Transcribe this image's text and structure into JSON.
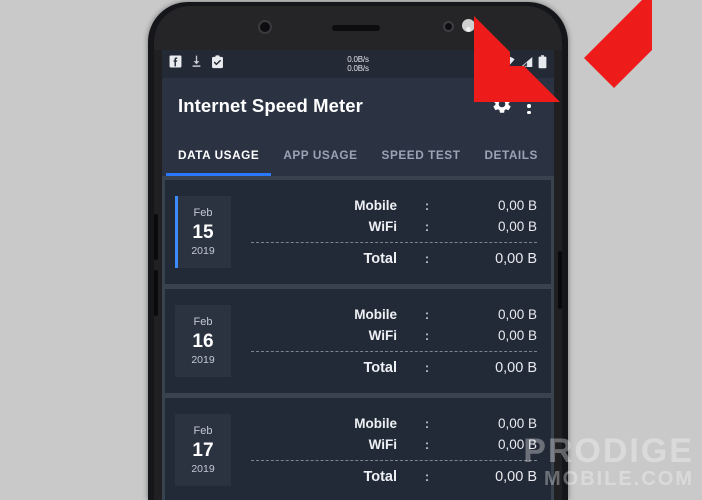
{
  "statusbar": {
    "left_icons": [
      "facebook-icon",
      "download-icon",
      "clipboard-check-icon"
    ],
    "speed_up": "0.0B/s",
    "speed_down": "0.0B/s",
    "right_icons": [
      "alarm-icon",
      "wifi-icon",
      "signal-icon",
      "battery-icon"
    ]
  },
  "appbar": {
    "title": "Internet Speed Meter",
    "settings_icon": "gear-icon",
    "overflow_icon": "more-vertical-icon"
  },
  "tabs": [
    {
      "label": "DATA USAGE",
      "active": true
    },
    {
      "label": "APP USAGE",
      "active": false
    },
    {
      "label": "SPEED TEST",
      "active": false
    },
    {
      "label": "DETAILS",
      "active": false
    }
  ],
  "rows_labels": {
    "mobile": "Mobile",
    "wifi": "WiFi",
    "total": "Total",
    "colon": ":"
  },
  "cards": [
    {
      "month": "Feb",
      "day": "15",
      "year": "2019",
      "accent": true,
      "mobile": "0,00 B",
      "wifi": "0,00 B",
      "total": "0,00 B"
    },
    {
      "month": "Feb",
      "day": "16",
      "year": "2019",
      "accent": false,
      "mobile": "0,00 B",
      "wifi": "0,00 B",
      "total": "0,00 B"
    },
    {
      "month": "Feb",
      "day": "17",
      "year": "2019",
      "accent": false,
      "mobile": "0,00 B",
      "wifi": "0,00 B",
      "total": "0,00 B"
    }
  ],
  "annotation": {
    "arrow_color": "#ee1b1b",
    "arrow_target": "gear-icon"
  },
  "watermark": {
    "line1": "PRODIGE",
    "line2": "MOBILE.COM"
  },
  "colors": {
    "accent": "#2979ff",
    "appbar": "#2b3342",
    "card": "#222a37",
    "list_bg": "#39424f",
    "page_bg": "#c9c9c9"
  }
}
